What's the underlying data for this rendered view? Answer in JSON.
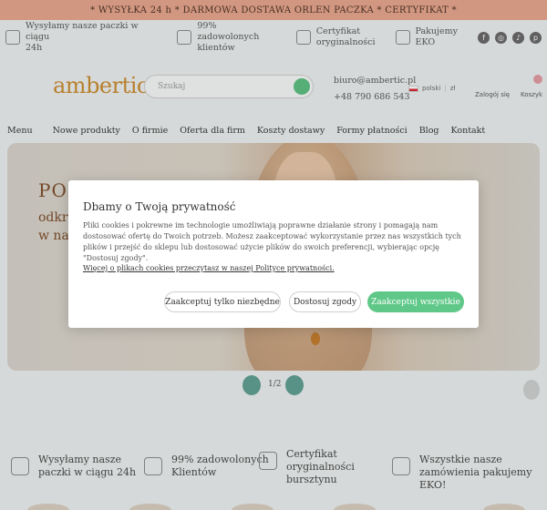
{
  "top_banner": {
    "text": "* WYSYŁKA 24 h * DARMOWA DOSTAWA ORLEN PACZKA * CERTYFIKAT *"
  },
  "benefits": [
    {
      "icon": "truck-icon",
      "line1": "Wysyłamy nasze paczki w ciągu",
      "line2": "24h"
    },
    {
      "icon": "star-icon",
      "line1": "99% zadowolonych",
      "line2": "klientów"
    },
    {
      "icon": "certificate-icon",
      "line1": "Certyfikat",
      "line2": "oryginalności"
    },
    {
      "icon": "eco-leaf-icon",
      "line1": "Pakujemy",
      "line2": "EKO"
    }
  ],
  "socials": [
    {
      "icon": "facebook-icon",
      "glyph": "f"
    },
    {
      "icon": "instagram-icon",
      "glyph": "◎"
    },
    {
      "icon": "tiktok-icon",
      "glyph": "♪"
    },
    {
      "icon": "pinterest-icon",
      "glyph": "p"
    }
  ],
  "header": {
    "logo": "ambertic",
    "logo_mark": "®",
    "search_placeholder": "Szukaj",
    "email": "biuro@ambertic.pl",
    "phone": "+48 790 686 543",
    "language": "polski",
    "currency": "zł",
    "wishlist": "Zalogój się",
    "cart": "Koszyk"
  },
  "nav": [
    "Menu",
    "Nowe produkty",
    "O firmie",
    "Oferta dla firm",
    "Koszty dostawy",
    "Formy płatności",
    "Blog",
    "Kontakt"
  ],
  "hero": {
    "title": "PON",
    "sub_line1": "odkry",
    "sub_line2": "w nas"
  },
  "slider": {
    "counter": "1/2"
  },
  "bottom_benefits": [
    {
      "icon": "truck-icon",
      "line1": "Wysyłamy nasze",
      "line2": "paczki w ciągu 24h",
      "line3": ""
    },
    {
      "icon": "star-icon",
      "line1": "99% zadowolonych",
      "line2": "Klientów",
      "line3": ""
    },
    {
      "icon": "certificate-icon",
      "line1": "Certyfikat",
      "line2": "oryginalności",
      "line3": "bursztynu"
    },
    {
      "icon": "eco-leaf-icon",
      "line1": "Wszystkie nasze",
      "line2": "zamówienia pakujemy EKO!",
      "line3": ""
    }
  ],
  "cookie_modal": {
    "title": "Dbamy o Twoją prywatność",
    "text": "Pliki cookies i pokrewne im technologie umożliwiają poprawne działanie strony i pomagają nam dostosować ofertę do Twoich potrzeb. Możesz zaakceptować wykorzystanie przez nas wszystkich tych plików i przejść do sklepu lub dostosować użycie plików do swoich preferencji, wybierając opcję \"Dostosuj zgody\".",
    "link": "Więcej o plikach cookies przeczytasz w naszej Polityce prywatności.",
    "btn_necessary": "Zaakceptuj tylko niezbędne",
    "btn_customize": "Dostosuj zgody",
    "btn_all": "Zaakceptuj wszystkie"
  }
}
